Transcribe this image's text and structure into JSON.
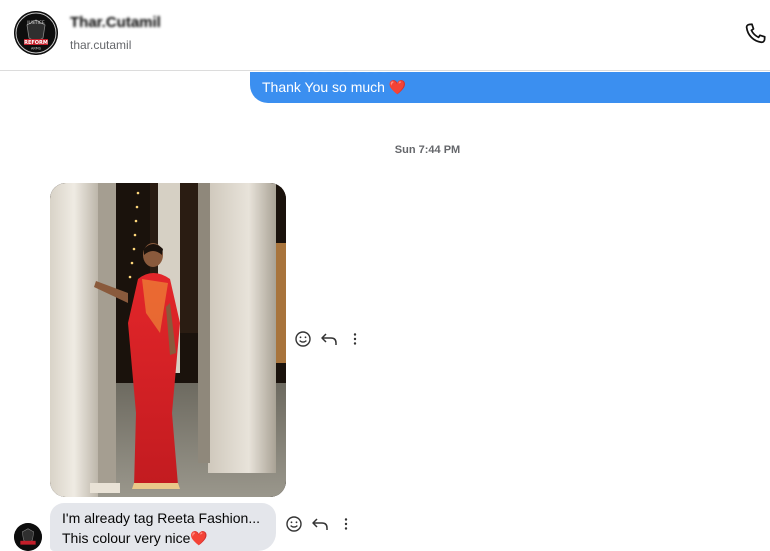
{
  "header": {
    "contact_name": "Thar.Cutamil",
    "contact_handle": "thar.cutamil",
    "avatar_text_top": "JUSTICE",
    "avatar_text_mid": "REFORM",
    "avatar_text_bot": "ARMS"
  },
  "messages": {
    "outgoing_text": "Thank You so much",
    "outgoing_emoji": "❤️",
    "timestamp": "Sun 7:44 PM",
    "incoming_line1": "I'm already tag Reeta Fashion...",
    "incoming_line2": "This colour very nice",
    "incoming_emoji": "❤️"
  },
  "icons": {
    "phone": "phone-icon",
    "react": "smiley-icon",
    "reply": "reply-icon",
    "more": "more-icon"
  },
  "colors": {
    "outgoing_bubble": "#3b8ff0",
    "incoming_bubble": "#e4e6eb",
    "heart": "#e0282e"
  }
}
